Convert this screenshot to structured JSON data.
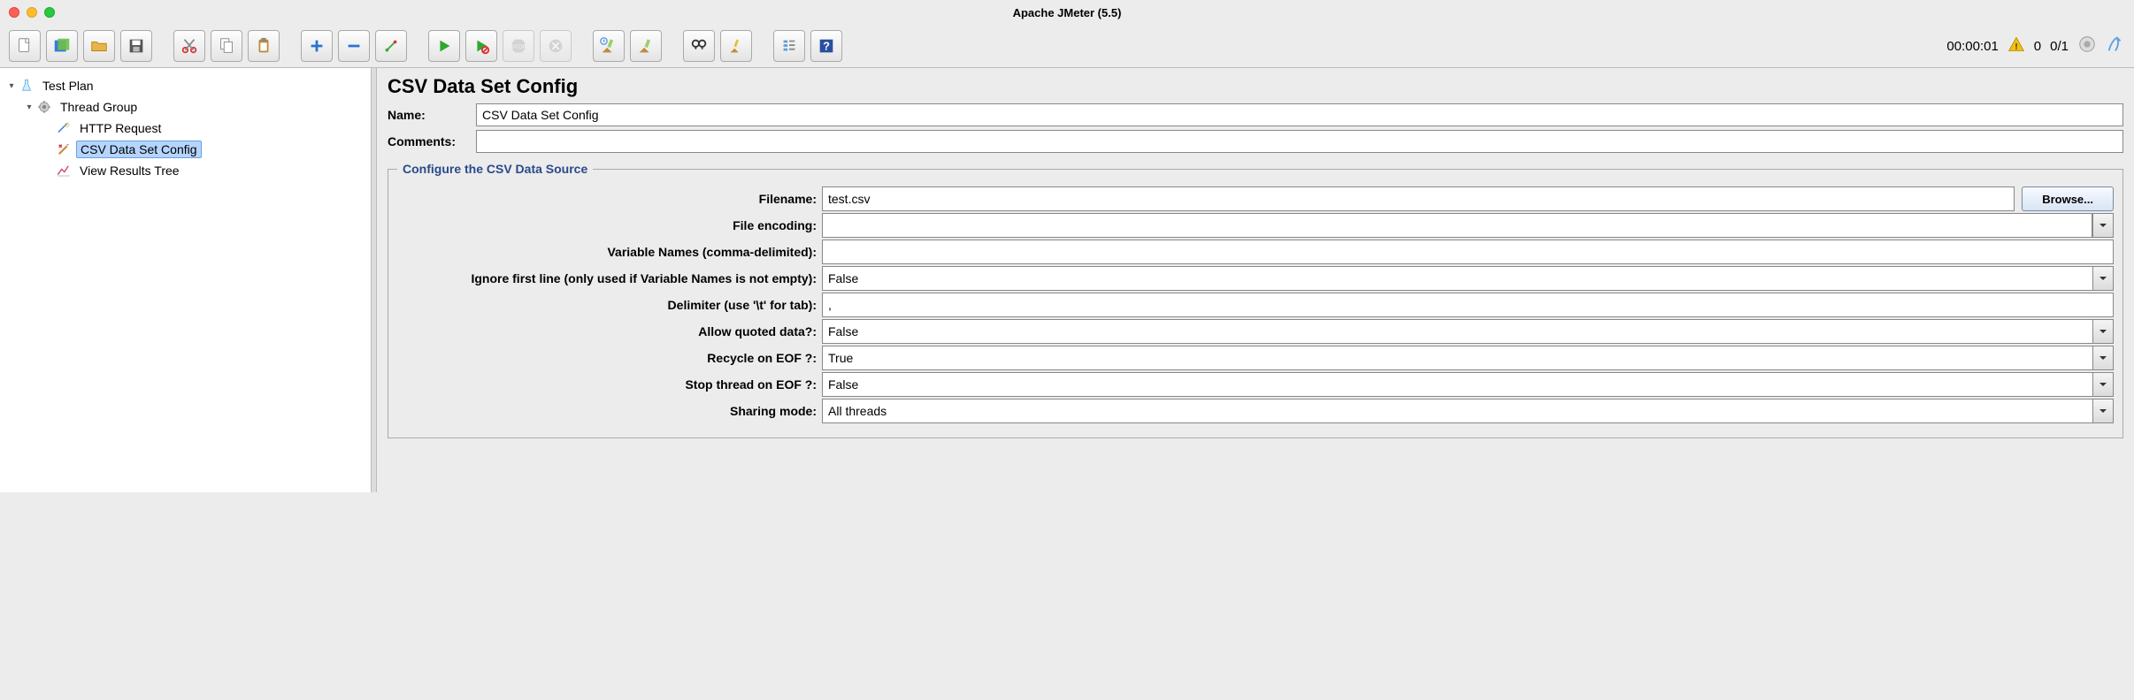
{
  "window": {
    "title": "Apache JMeter (5.5)"
  },
  "toolbar_right": {
    "elapsed": "00:00:01",
    "warnings": "0",
    "threads": "0/1"
  },
  "tree": {
    "testplan": "Test Plan",
    "threadgroup": "Thread Group",
    "http": "HTTP Request",
    "csv": "CSV Data Set Config",
    "results": "View Results Tree"
  },
  "panel": {
    "title": "CSV Data Set Config",
    "name_label": "Name:",
    "name_value": "CSV Data Set Config",
    "comments_label": "Comments:",
    "comments_value": "",
    "fieldset_legend": "Configure the CSV Data Source",
    "browse_label": "Browse...",
    "rows": {
      "filename_label": "Filename:",
      "filename_value": "test.csv",
      "encoding_label": "File encoding:",
      "encoding_value": "",
      "varnames_label": "Variable Names (comma-delimited):",
      "varnames_value": "",
      "ignorefirst_label": "Ignore first line (only used if Variable Names is not empty):",
      "ignorefirst_value": "False",
      "delimiter_label": "Delimiter (use '\\t' for tab):",
      "delimiter_value": ",",
      "quoted_label": "Allow quoted data?:",
      "quoted_value": "False",
      "recycle_label": "Recycle on EOF ?:",
      "recycle_value": "True",
      "stop_label": "Stop thread on EOF ?:",
      "stop_value": "False",
      "sharing_label": "Sharing mode:",
      "sharing_value": "All threads"
    }
  }
}
